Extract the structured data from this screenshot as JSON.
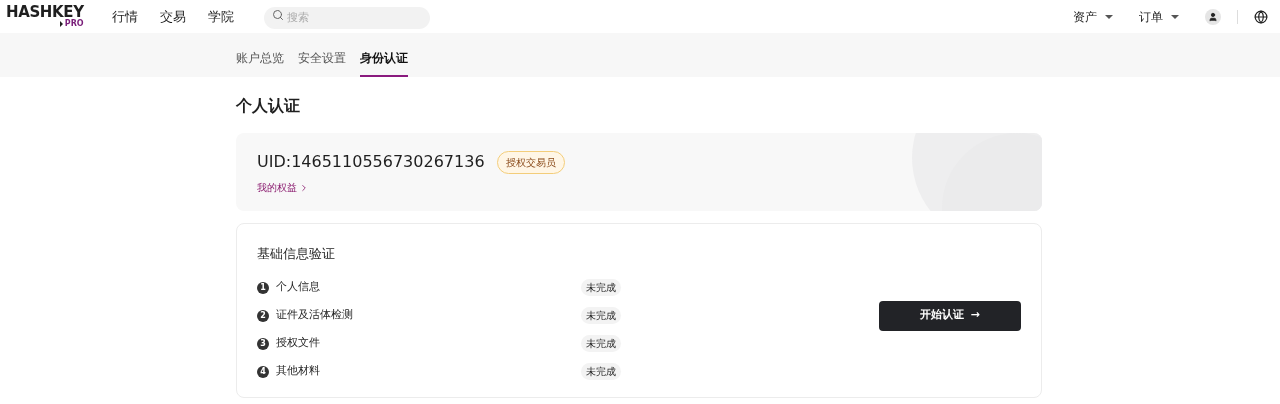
{
  "logo": {
    "name": "HASHKEY",
    "sub": "PRO"
  },
  "nav": [
    "行情",
    "交易",
    "学院"
  ],
  "search": {
    "placeholder": "搜索"
  },
  "header_menus": [
    "资产",
    "订单"
  ],
  "tabs": [
    {
      "label": "账户总览",
      "selected": false
    },
    {
      "label": "安全设置",
      "selected": false
    },
    {
      "label": "身份认证",
      "selected": true
    }
  ],
  "page_title": "个人认证",
  "account": {
    "uid": "UID:1465110556730267136",
    "badge": "授权交易员",
    "link": "我的权益"
  },
  "verification": {
    "title": "基础信息验证",
    "steps": [
      {
        "number": "1",
        "label": "个人信息",
        "status": "未完成"
      },
      {
        "number": "2",
        "label": "证件及活体检测",
        "status": "未完成"
      },
      {
        "number": "3",
        "label": "授权文件",
        "status": "未完成"
      },
      {
        "number": "4",
        "label": "其他材料",
        "status": "未完成"
      }
    ],
    "button": {
      "label": "开始认证",
      "arrow": "→"
    }
  }
}
